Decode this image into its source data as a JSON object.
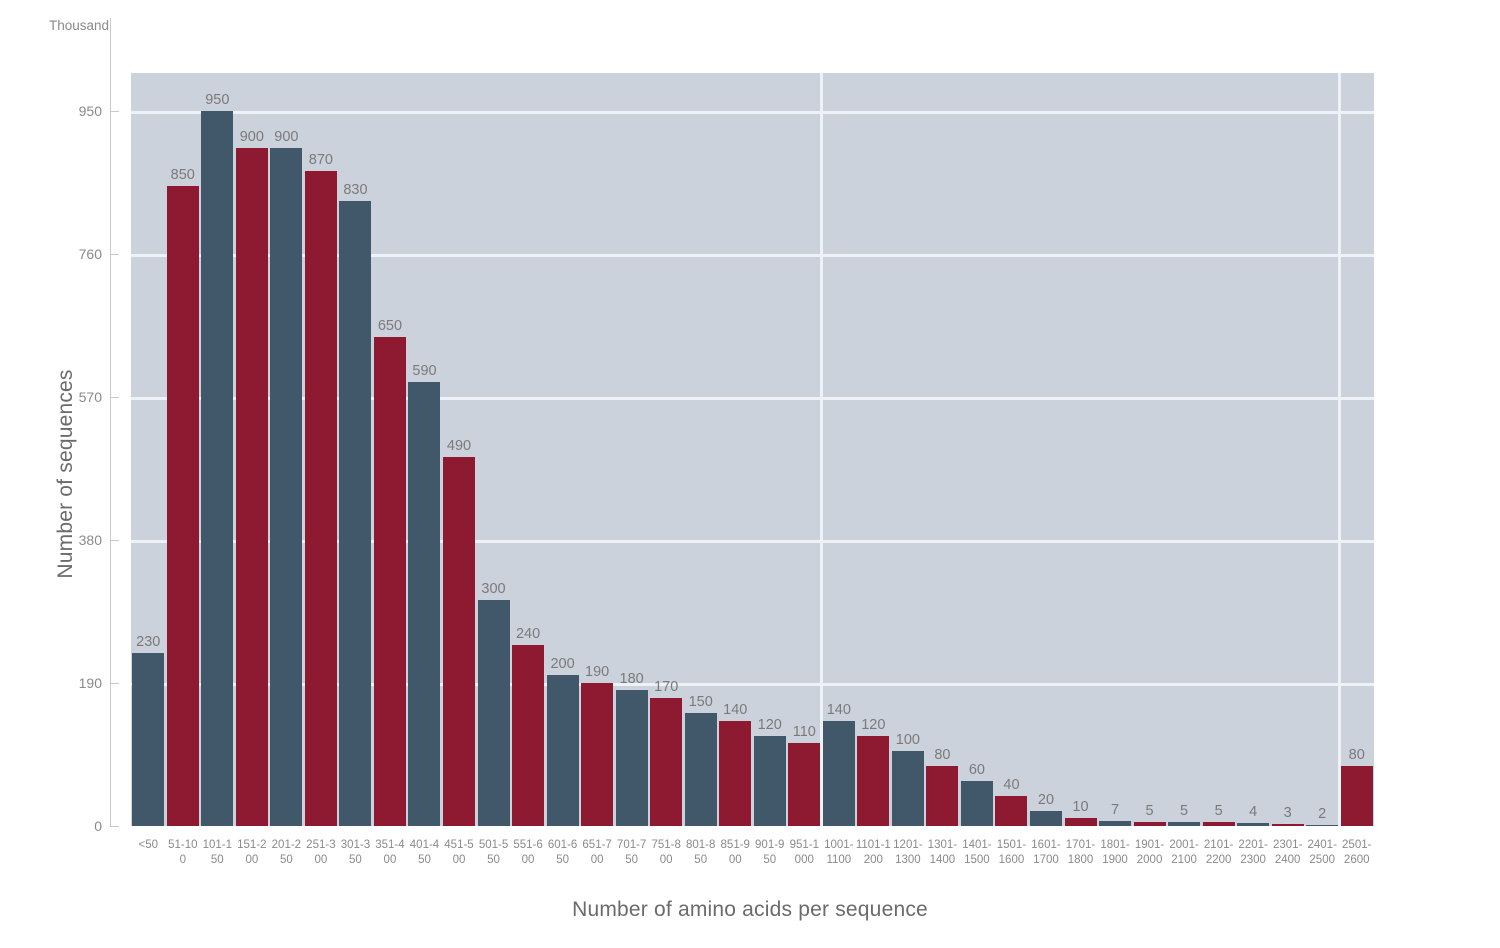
{
  "chart_data": {
    "type": "bar",
    "title": "",
    "xlabel": "Number of amino acids per sequence",
    "ylabel": "Number of sequences",
    "y_unit_label": "Thousand",
    "ylim": [
      0,
      1000
    ],
    "y_ticks": [
      0,
      190,
      380,
      570,
      760,
      950
    ],
    "y_tick_labels": [
      "0",
      "190",
      "380",
      "570",
      "760",
      "950"
    ],
    "grid": {
      "horizontal": true,
      "vertical": true
    },
    "legend": null,
    "bar_colors": {
      "blue": "#41586b",
      "crimson": "#8e1a32"
    },
    "plot_background": "#ccd2dc",
    "gridline_color": "#eef1f5",
    "categories": [
      "<50",
      "51-100",
      "101-150",
      "151-200",
      "201-250",
      "251-300",
      "301-350",
      "351-400",
      "401-450",
      "451-500",
      "501-550",
      "551-600",
      "601-650",
      "651-700",
      "701-750",
      "751-800",
      "801-850",
      "851-900",
      "901-950",
      "951-1000",
      "1001-1100",
      "1101-1200",
      "1201-1300",
      "1301-1400",
      "1401-1500",
      "1501-1600",
      "1601-1700",
      "1701-1800",
      "1801-1900",
      "1901-2000",
      "2001-2100",
      "2101-2200",
      "2201-2300",
      "2301-2400",
      "2401-2500",
      "2501-2600"
    ],
    "values": [
      230,
      850,
      950,
      900,
      900,
      870,
      830,
      650,
      590,
      490,
      300,
      240,
      200,
      190,
      180,
      170,
      150,
      140,
      120,
      110,
      140,
      120,
      100,
      80,
      60,
      40,
      20,
      10,
      7,
      5,
      5,
      5,
      4,
      3,
      2,
      80
    ],
    "value_labels": [
      "230",
      "850",
      "950",
      "900",
      "900",
      "870",
      "830",
      "650",
      "590",
      "490",
      "300",
      "240",
      "200",
      "190",
      "180",
      "170",
      "150",
      "140",
      "120",
      "110",
      "140",
      "120",
      "100",
      "80",
      "60",
      "40",
      "20",
      "10",
      "7",
      "5",
      "5",
      "5",
      "4",
      "3",
      "2",
      "80"
    ],
    "series_color_pattern": [
      "blue",
      "crimson",
      "blue",
      "crimson",
      "blue",
      "crimson",
      "blue",
      "crimson",
      "blue",
      "crimson",
      "blue",
      "crimson",
      "blue",
      "crimson",
      "blue",
      "crimson",
      "blue",
      "crimson",
      "blue",
      "crimson",
      "blue",
      "crimson",
      "blue",
      "crimson",
      "blue",
      "crimson",
      "blue",
      "crimson",
      "blue",
      "crimson",
      "blue",
      "crimson",
      "blue",
      "crimson",
      "blue",
      "crimson"
    ]
  }
}
